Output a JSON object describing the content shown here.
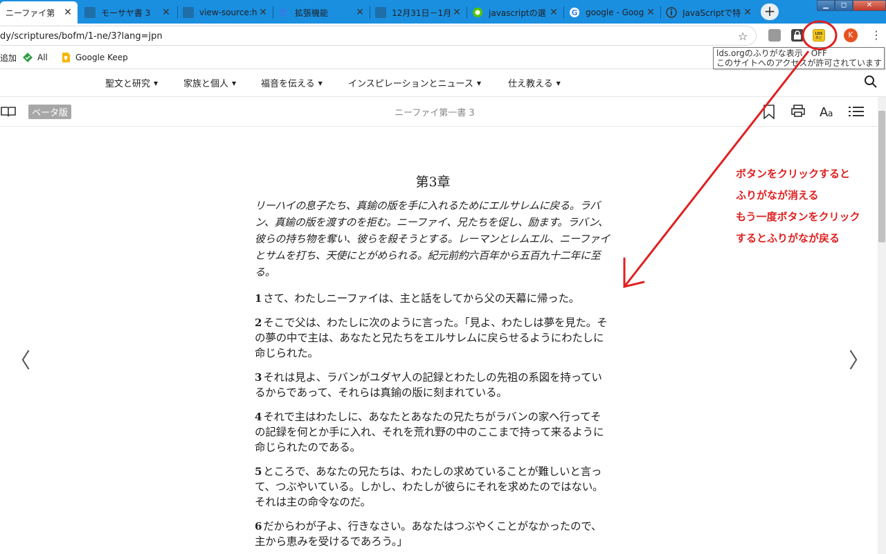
{
  "browser": {
    "tabs": [
      {
        "label": "ニーファイ第",
        "close": "✕",
        "favicon_color": "#ffffff"
      },
      {
        "label": "モーサヤ書 3",
        "close": "✕",
        "favicon_color": "#1e6fa8"
      },
      {
        "label": "view-source:h",
        "close": "✕",
        "favicon_color": "#1e6fa8"
      },
      {
        "label": "拡張機能",
        "close": "✕",
        "favicon_color": "#3b78e7"
      },
      {
        "label": "12月31日－1月",
        "close": "✕",
        "favicon_color": "#1e6fa8"
      },
      {
        "label": "javascriptの選",
        "close": "✕",
        "favicon_color": "#6fb83a"
      },
      {
        "label": "google - Goog",
        "close": "✕",
        "favicon_color": "#4285f4"
      },
      {
        "label": "JavaScriptで特",
        "close": "✕",
        "favicon_color": "#555555"
      }
    ],
    "new_tab": "+",
    "window_controls": {
      "minimize": "▁",
      "maximize": "◻",
      "close": "✕"
    },
    "url": "dy/scriptures/bofm/1-ne/3?lang=jpn",
    "star": "☆",
    "profile_initial": "K",
    "menu": "⋮",
    "bookmarks": [
      {
        "label": "追加",
        "icon": "none"
      },
      {
        "label": "All",
        "icon": "green-diamond-icon"
      },
      {
        "label": "Google Keep",
        "icon": "keep-icon"
      }
    ],
    "tooltip": {
      "line1": "lds.orgのふりがな表示　OFF",
      "line2": "このサイトへのアクセスが許可されています"
    }
  },
  "site_nav": {
    "items": [
      {
        "label": "聖文と研究",
        "caret": "▼"
      },
      {
        "label": "家族と個人",
        "caret": "▼"
      },
      {
        "label": "福音を伝える",
        "caret": "▼"
      },
      {
        "label": "インスピレーションとニュース",
        "caret": "▼"
      },
      {
        "label": "仕え教える",
        "caret": "▼"
      }
    ]
  },
  "reader": {
    "beta_label": "ベータ版",
    "chapter_name": "ニーファイ第一書 3",
    "prev": "〈",
    "next": "〉"
  },
  "content": {
    "chapter_title": "第3章",
    "summary": "リーハイの息子たち、真鍮の版を手に入れるためにエルサレムに戻る。ラバン、真鍮の版を渡すのを拒む。ニーファイ、兄たちを促し、励ます。ラバン、彼らの持ち物を奪い、彼らを殺そうとする。レーマンとレムエル、ニーファイとサムを打ち、天使にとがめられる。紀元前約六百年から五百九十二年に至る。",
    "verses": [
      {
        "num": "1",
        "text": "さて、わたしニーファイは、主と話をしてから父の天幕に帰った。"
      },
      {
        "num": "2",
        "text": "そこで父は、わたしに次のように言った。「見よ、わたしは夢を見た。その夢の中で主は、あなたと兄たちをエルサレムに戻らせるようにわたしに命じられた。"
      },
      {
        "num": "3",
        "text": "それは見よ、ラバンがユダヤ人の記録とわたしの先祖の系図を持っているからであって、それらは真鍮の版に刻まれている。"
      },
      {
        "num": "4",
        "text": "それで主はわたしに、あなたとあなたの兄たちがラバンの家へ行ってその記録を何とか手に入れ、それを荒れ野の中のここまで持って来るように命じられたのである。"
      },
      {
        "num": "5",
        "text": "ところで、あなたの兄たちは、わたしの求めていることが難しいと言って、つぶやいている。しかし、わたしが彼らにそれを求めたのではない。それは主の命令なのだ。"
      },
      {
        "num": "6",
        "text": "だからわが子よ、行きなさい。あなたはつぶやくことがなかったので、主から恵みを受けるであろう。」"
      }
    ]
  },
  "annotation": {
    "lines": [
      "ボタンをクリックすると",
      "ふりがなが消える",
      "もう一度ボタンをクリック",
      "するとふりがなが戻る"
    ],
    "color": "#e02020"
  }
}
